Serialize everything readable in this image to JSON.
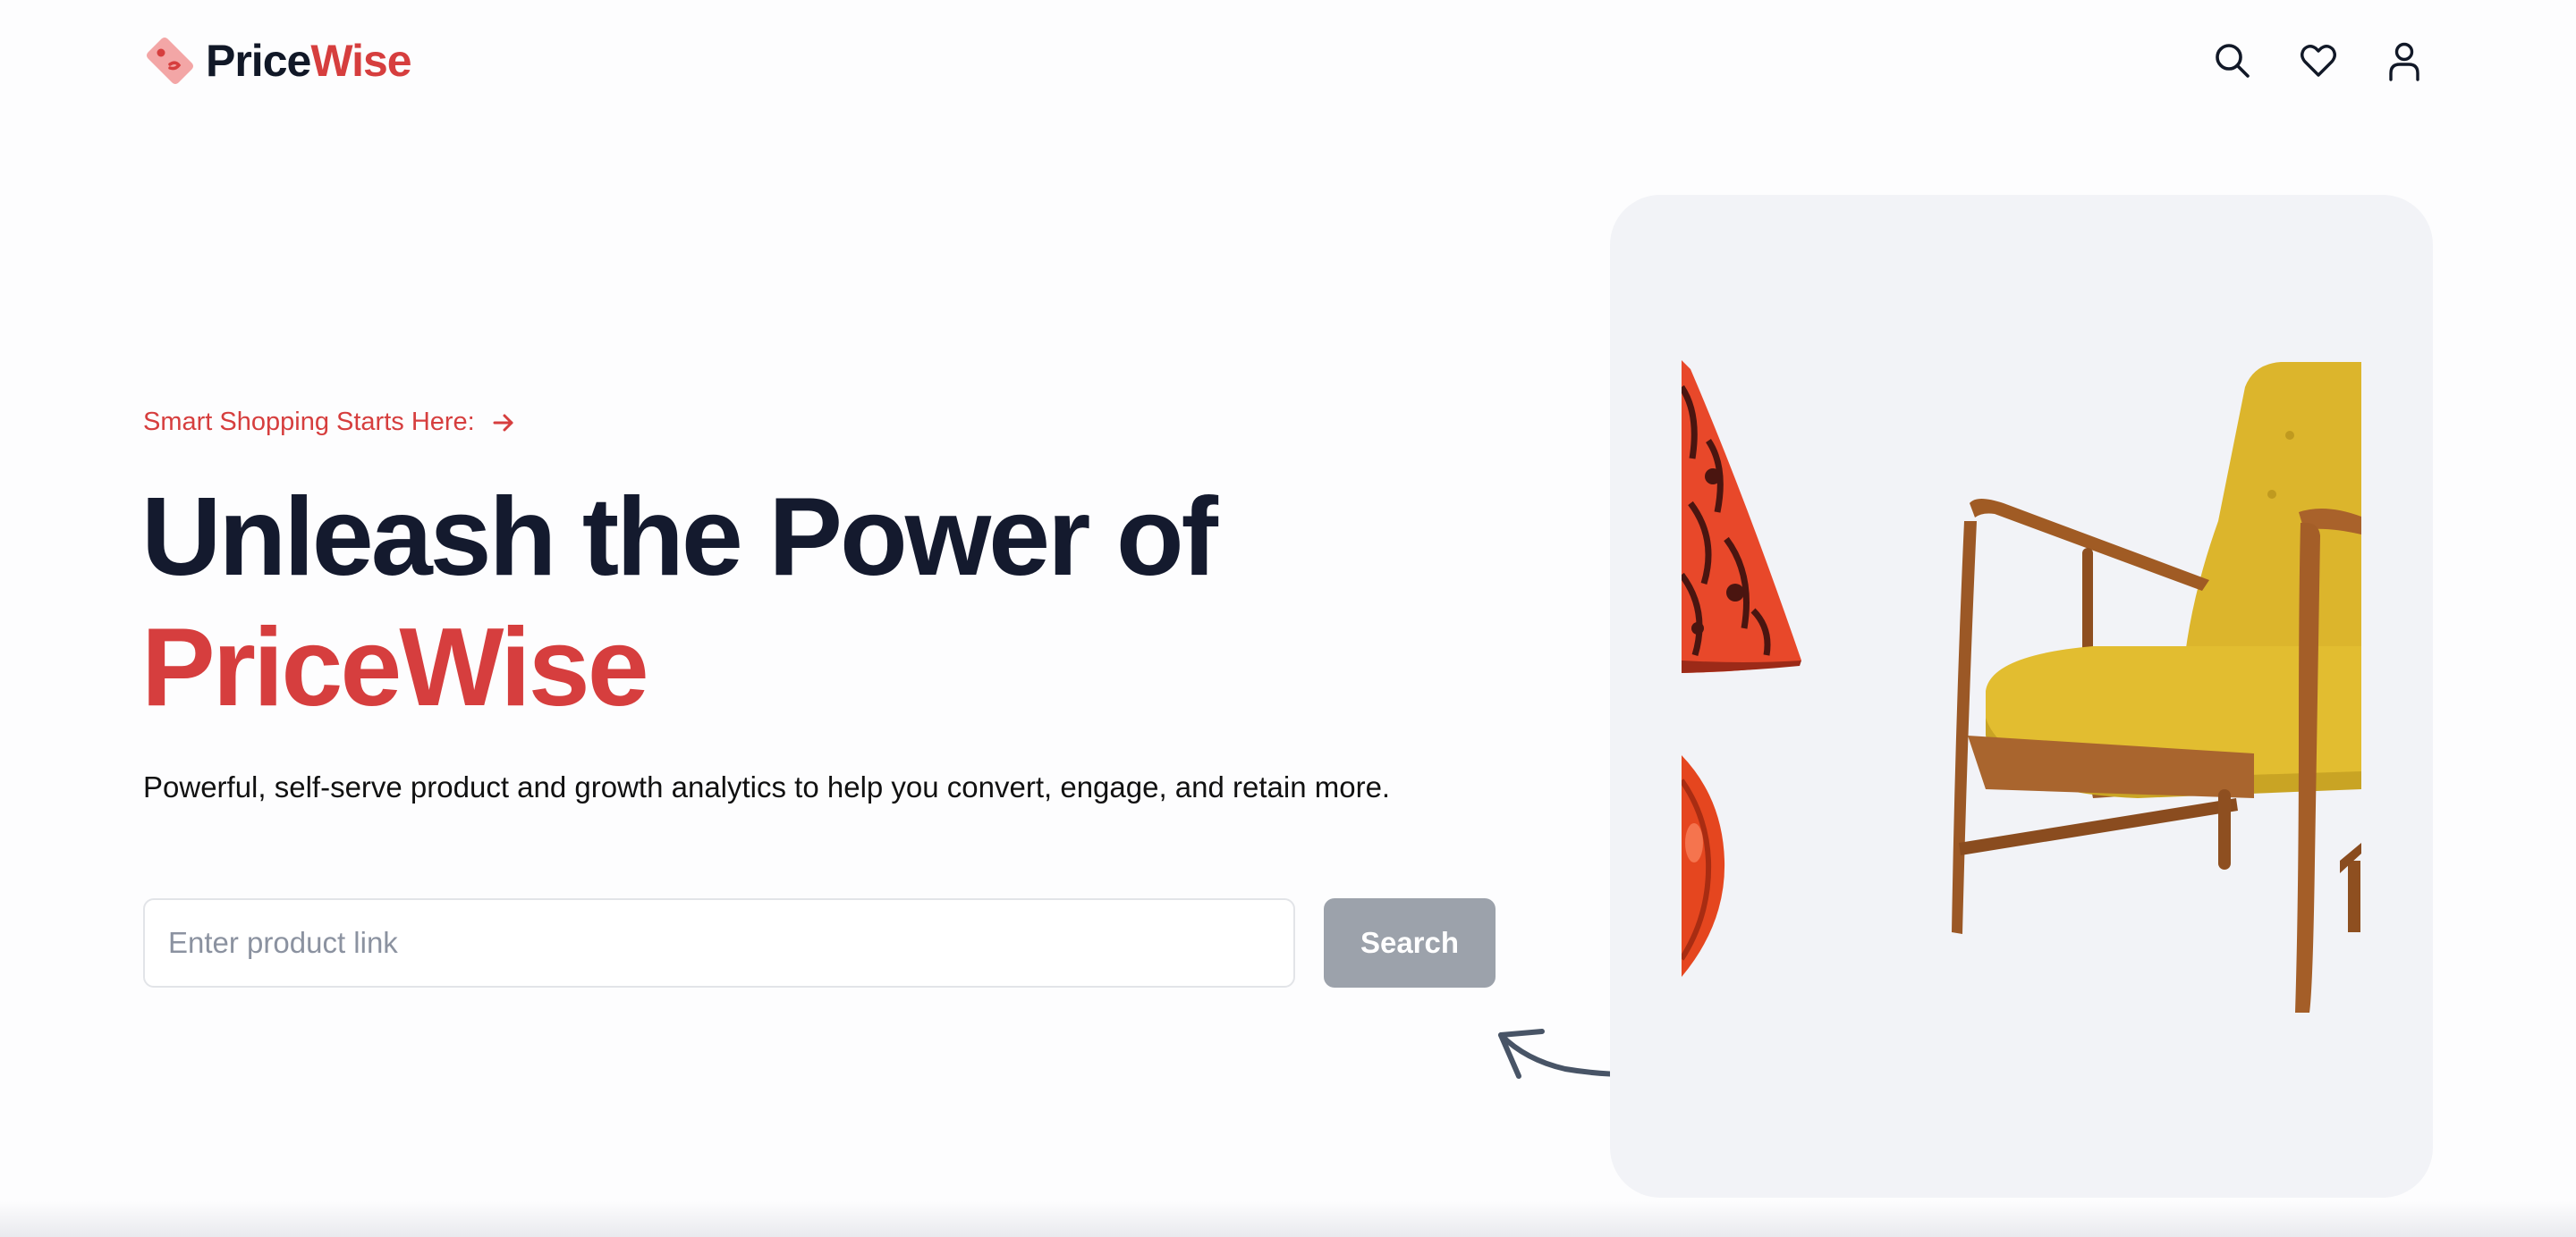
{
  "nav": {
    "logo": {
      "text_main": "Price",
      "text_accent": "Wise",
      "icon": "price-tag-icon"
    },
    "icons": [
      "search-icon",
      "heart-icon",
      "user-icon"
    ]
  },
  "hero": {
    "tagline": "Smart Shopping Starts Here:",
    "headline_line1": "Unleash the Power of",
    "headline_brand": "PriceWise",
    "subtext": "Powerful, self-serve product and growth analytics to help you convert, engage, and retain more.",
    "search": {
      "placeholder": "Enter product link",
      "value": "",
      "button_label": "Search"
    }
  },
  "colors": {
    "accent": "#d63e3e",
    "heading": "#141a2e",
    "button_disabled": "#9ca2ab",
    "card_bg": "#f2f3f7"
  }
}
